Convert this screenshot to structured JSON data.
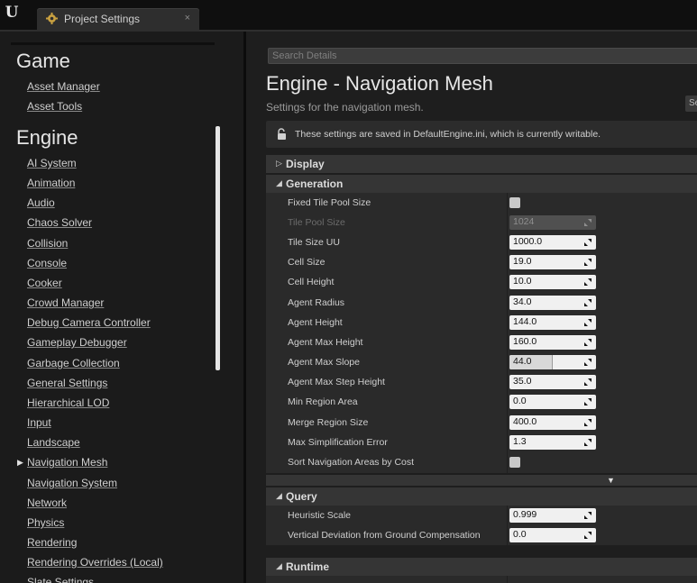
{
  "window": {
    "tab_title": "Project Settings",
    "tab_close": "×",
    "logo_glyph": "U"
  },
  "sidebar": {
    "sections": [
      {
        "heading": "Game",
        "items": [
          {
            "label": "Asset Manager"
          },
          {
            "label": "Asset Tools"
          }
        ]
      },
      {
        "heading": "Engine",
        "items": [
          {
            "label": "AI System"
          },
          {
            "label": "Animation"
          },
          {
            "label": "Audio"
          },
          {
            "label": "Chaos Solver"
          },
          {
            "label": "Collision"
          },
          {
            "label": "Console"
          },
          {
            "label": "Cooker"
          },
          {
            "label": "Crowd Manager"
          },
          {
            "label": "Debug Camera Controller"
          },
          {
            "label": "Gameplay Debugger"
          },
          {
            "label": "Garbage Collection"
          },
          {
            "label": "General Settings"
          },
          {
            "label": "Hierarchical LOD"
          },
          {
            "label": "Input"
          },
          {
            "label": "Landscape"
          },
          {
            "label": "Navigation Mesh"
          },
          {
            "label": "Navigation System"
          },
          {
            "label": "Network"
          },
          {
            "label": "Physics"
          },
          {
            "label": "Rendering"
          },
          {
            "label": "Rendering Overrides (Local)"
          },
          {
            "label": "Slate Settings"
          }
        ]
      }
    ],
    "selected_item": "Navigation Mesh",
    "selected_marker": "▶"
  },
  "details": {
    "search_placeholder": "Search Details",
    "title": "Engine - Navigation Mesh",
    "subtitle": "Settings for the navigation mesh.",
    "side_button": "Se",
    "notice": "These settings are saved in DefaultEngine.ini, which is currently writable.",
    "categories": {
      "display": {
        "label": "Display",
        "arrow": "▷",
        "expanded": false
      },
      "generation": {
        "label": "Generation",
        "arrow": "◢",
        "expanded": true
      },
      "query": {
        "label": "Query",
        "arrow": "◢",
        "expanded": true
      },
      "runtime": {
        "label": "Runtime",
        "arrow": "◢",
        "expanded": true
      }
    },
    "generation_rows": [
      {
        "label": "Fixed Tile Pool Size",
        "type": "checkbox",
        "checked": false
      },
      {
        "label": "Tile Pool Size",
        "type": "number",
        "value": "1024",
        "disabled": true
      },
      {
        "label": "Tile Size UU",
        "type": "number",
        "value": "1000.0"
      },
      {
        "label": "Cell Size",
        "type": "number",
        "value": "19.0"
      },
      {
        "label": "Cell Height",
        "type": "number",
        "value": "10.0"
      },
      {
        "label": "Agent Radius",
        "type": "number",
        "value": "34.0"
      },
      {
        "label": "Agent Height",
        "type": "number",
        "value": "144.0"
      },
      {
        "label": "Agent Max Height",
        "type": "number",
        "value": "160.0"
      },
      {
        "label": "Agent Max Slope",
        "type": "slider",
        "value": "44.0",
        "fraction": 0.49
      },
      {
        "label": "Agent Max Step Height",
        "type": "number",
        "value": "35.0"
      },
      {
        "label": "Min Region Area",
        "type": "number",
        "value": "0.0"
      },
      {
        "label": "Merge Region Size",
        "type": "number",
        "value": "400.0"
      },
      {
        "label": "Max Simplification Error",
        "type": "number",
        "value": "1.3"
      },
      {
        "label": "Sort Navigation Areas by Cost",
        "type": "checkbox",
        "checked": false
      }
    ],
    "advanced_arrow": "▼",
    "query_rows": [
      {
        "label": "Heuristic Scale",
        "type": "number",
        "value": "0.999"
      },
      {
        "label": "Vertical Deviation from Ground Compensation",
        "type": "number",
        "value": "0.0"
      }
    ]
  },
  "colors": {
    "field_bg": "#f0f0f0",
    "panel_bg": "#2a2a2a",
    "category_bg": "#353535",
    "sidebar_bg": "#1b1b1b"
  }
}
